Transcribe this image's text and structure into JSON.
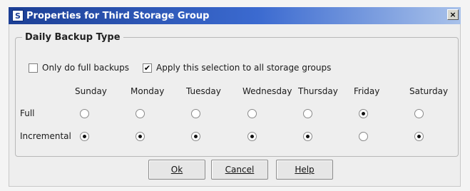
{
  "window": {
    "title": "Properties for Third Storage Group",
    "app_icon_glyph": "S",
    "close_glyph": "×"
  },
  "group": {
    "legend": "Daily Backup Type"
  },
  "options": {
    "full_only": {
      "label": "Only do full backups",
      "checked": false
    },
    "apply_all": {
      "label": "Apply this selection to all storage groups",
      "checked": true,
      "check_glyph": "✔"
    }
  },
  "schedule": {
    "days": [
      "Sunday",
      "Monday",
      "Tuesday",
      "Wednesday",
      "Thursday",
      "Friday",
      "Saturday"
    ],
    "rows": {
      "full": {
        "label": "Full",
        "selected": [
          false,
          false,
          false,
          false,
          false,
          true,
          false
        ]
      },
      "incremental": {
        "label": "Incremental",
        "selected": [
          true,
          true,
          true,
          true,
          true,
          false,
          true
        ]
      }
    }
  },
  "buttons": {
    "ok": "Ok",
    "cancel": "Cancel",
    "help": "Help"
  }
}
